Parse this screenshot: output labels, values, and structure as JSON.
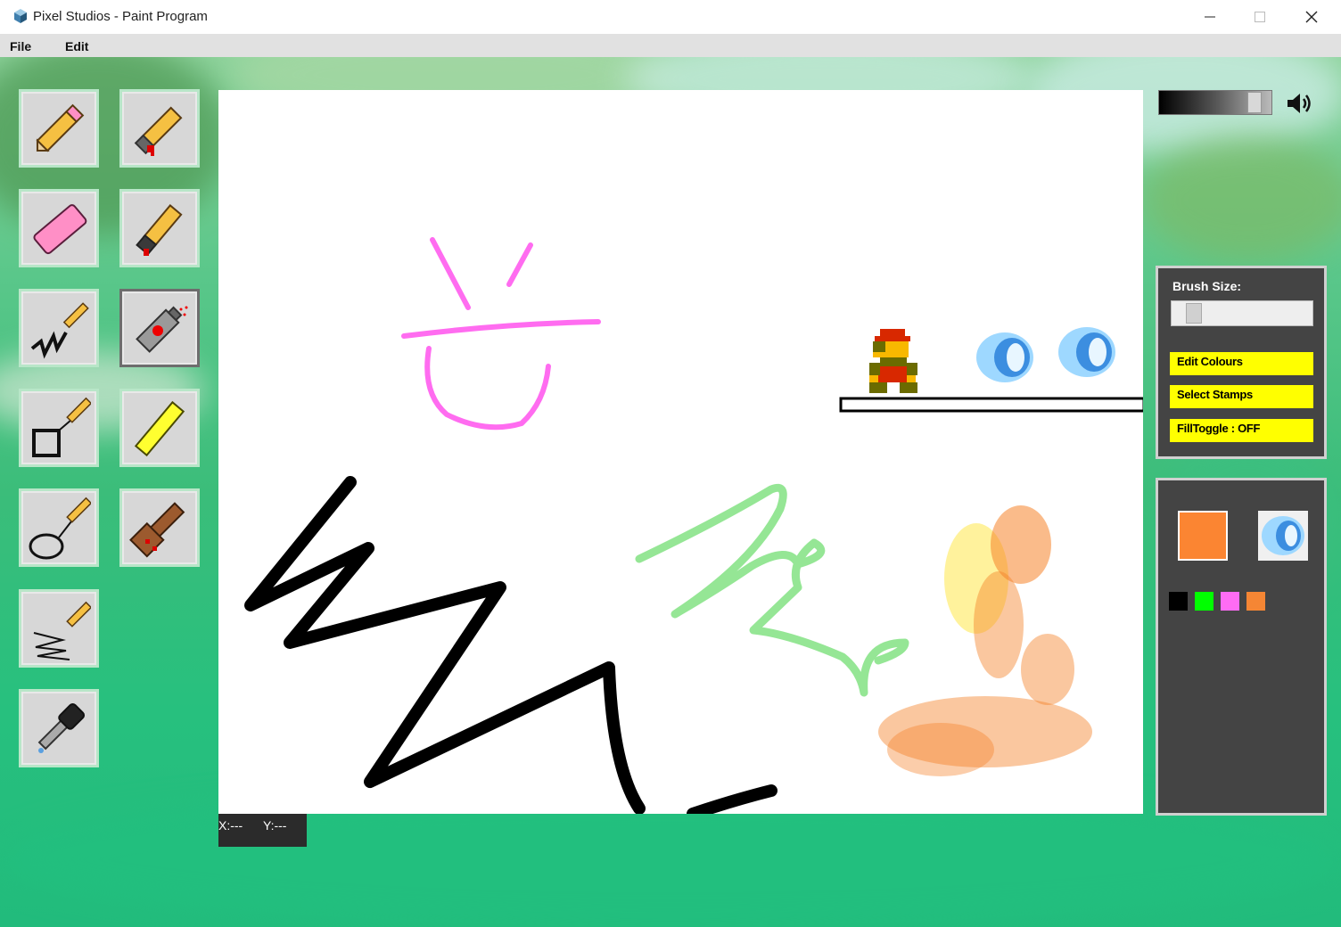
{
  "window": {
    "title": "Pixel Studios - Paint Program"
  },
  "menu": {
    "items": [
      "File",
      "Edit"
    ]
  },
  "tools": [
    {
      "name": "pencil-tool",
      "icon": "pink-pencil-icon"
    },
    {
      "name": "bloody-pencil-tool",
      "icon": "bloody-pencil-icon"
    },
    {
      "name": "eraser-tool",
      "icon": "eraser-icon"
    },
    {
      "name": "marker-tool",
      "icon": "marker-icon"
    },
    {
      "name": "line-tool",
      "icon": "squiggle-line-icon"
    },
    {
      "name": "spray-tool",
      "icon": "spray-can-icon"
    },
    {
      "name": "rectangle-tool",
      "icon": "rectangle-icon"
    },
    {
      "name": "highlighter-tool",
      "icon": "highlighter-icon"
    },
    {
      "name": "ellipse-tool",
      "icon": "ellipse-icon"
    },
    {
      "name": "brush-tool",
      "icon": "brush-icon"
    },
    {
      "name": "polyline-tool",
      "icon": "polyline-icon"
    },
    {
      "name": "eyedropper-tool",
      "icon": "eyedropper-icon"
    }
  ],
  "selected_tool": "spray-tool",
  "status": {
    "x_label": "X:---",
    "y_label": "Y:---"
  },
  "volume": {
    "level": 0.9,
    "icon": "speaker-icon"
  },
  "settings_panel": {
    "brush_size_label": "Brush Size:",
    "brush_size_value": 0.1,
    "edit_colours_label": "Edit Colours",
    "select_stamps_label": "Select Stamps",
    "fill_toggle_label": "FillToggle : OFF"
  },
  "colors": {
    "current": "#fb8532",
    "palette": [
      "#000000",
      "#00ff00",
      "#ff6cf4",
      "#f58634"
    ],
    "accent_button": "#ffff00",
    "panel_bg": "#444444"
  },
  "current_stamp": "blue-fireball-icon"
}
